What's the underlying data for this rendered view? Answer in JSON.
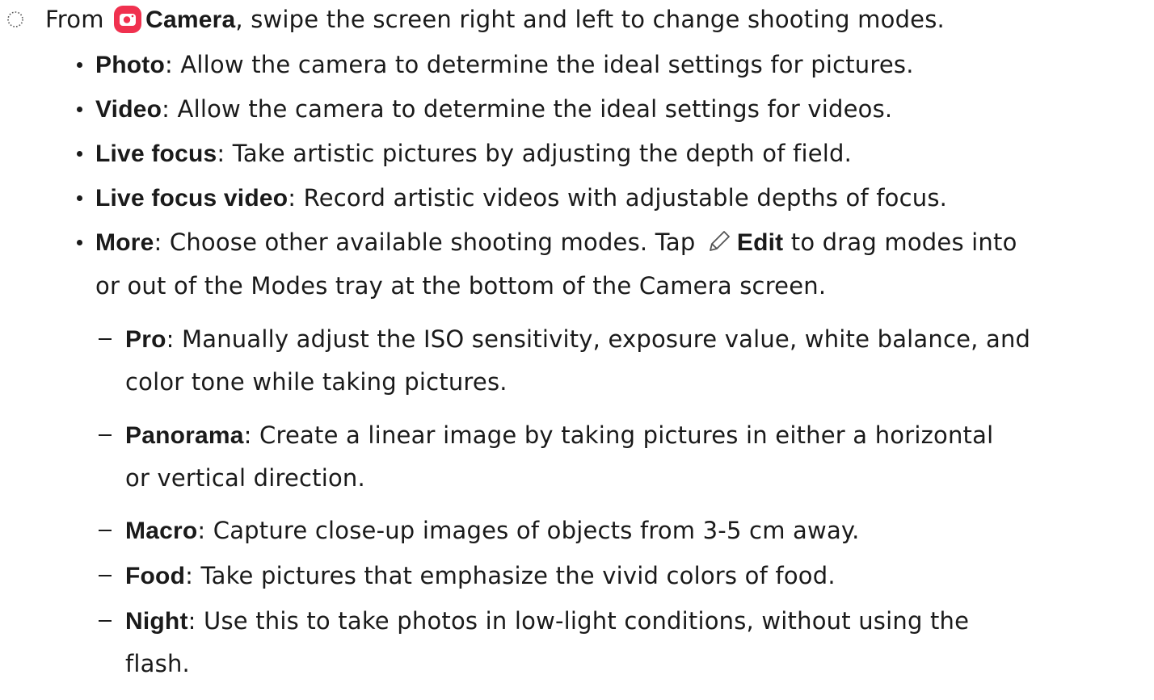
{
  "intro": {
    "from": "From",
    "camera_label": "Camera",
    "rest": ", swipe the screen right and left to change shooting modes."
  },
  "modes": [
    {
      "term": "Photo",
      "desc": ": Allow the camera to determine the ideal settings for pictures."
    },
    {
      "term": "Video",
      "desc": ": Allow the camera to determine the ideal settings for videos."
    },
    {
      "term": "Live focus",
      "desc": ": Take artistic pictures by adjusting the depth of field."
    },
    {
      "term": "Live focus video",
      "desc": ": Record artistic videos with adjustable depths of focus."
    }
  ],
  "more": {
    "term": "More",
    "desc_a": ": Choose other available shooting modes. Tap",
    "edit_label": "Edit",
    "desc_b": "to drag modes into",
    "desc_c": "or out of the Modes tray at the bottom of the Camera screen."
  },
  "submodes": [
    {
      "term": "Pro",
      "desc": ": Manually adjust the ISO sensitivity, exposure value, white balance, and",
      "cont": "color tone while taking pictures."
    },
    {
      "term": "Panorama",
      "desc": ": Create a linear image by taking pictures in either a horizontal",
      "cont": "or vertical direction."
    },
    {
      "term": "Macro",
      "desc": ": Capture close-up images of objects from 3-5 cm away.",
      "cont": ""
    },
    {
      "term": "Food",
      "desc": ": Take pictures that emphasize the vivid colors of food.",
      "cont": ""
    },
    {
      "term": "Night",
      "desc": ": Use this to take photos in low-light conditions, without using the",
      "cont": "flash."
    }
  ],
  "icons": {
    "step": "step-circle-icon",
    "camera": "camera-app-icon",
    "edit": "pencil-edit-icon",
    "camera_color": "#f0314f"
  }
}
